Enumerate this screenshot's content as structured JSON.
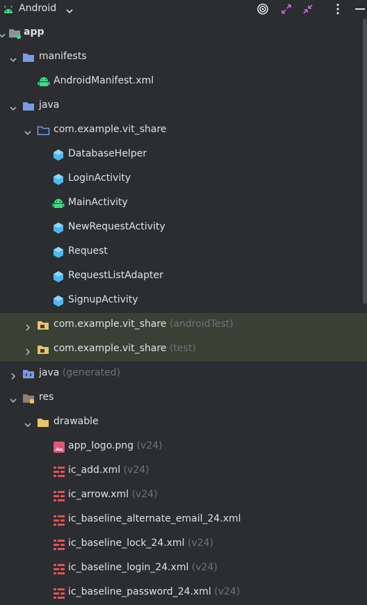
{
  "header": {
    "title": "Android",
    "colors": {
      "android_green": "#3ddc84",
      "bg": "#2b2d30"
    }
  },
  "tree": {
    "app": "app",
    "manifests": "manifests",
    "android_manifest": "AndroidManifest.xml",
    "java": "java",
    "pkg_main": "com.example.vit_share",
    "classes": [
      "DatabaseHelper",
      "LoginActivity",
      "MainActivity",
      "NewRequestActivity",
      "Request",
      "RequestListAdapter",
      "SignupActivity"
    ],
    "pkg_android_test": {
      "name": "com.example.vit_share",
      "hint": "(androidTest)"
    },
    "pkg_test": {
      "name": "com.example.vit_share",
      "hint": "(test)"
    },
    "java_generated": {
      "name": "java",
      "hint": "(generated)"
    },
    "res": "res",
    "drawable": "drawable",
    "drawables": [
      {
        "name": "app_logo.png",
        "hint": "(v24)"
      },
      {
        "name": "ic_add.xml",
        "hint": "(v24)"
      },
      {
        "name": "ic_arrow.xml",
        "hint": "(v24)"
      },
      {
        "name": "ic_baseline_alternate_email_24.xml",
        "hint": ""
      },
      {
        "name": "ic_baseline_lock_24.xml",
        "hint": "(v24)"
      },
      {
        "name": "ic_baseline_login_24.xml",
        "hint": "(v24)"
      },
      {
        "name": "ic_baseline_password_24.xml",
        "hint": "(v24)"
      }
    ]
  }
}
